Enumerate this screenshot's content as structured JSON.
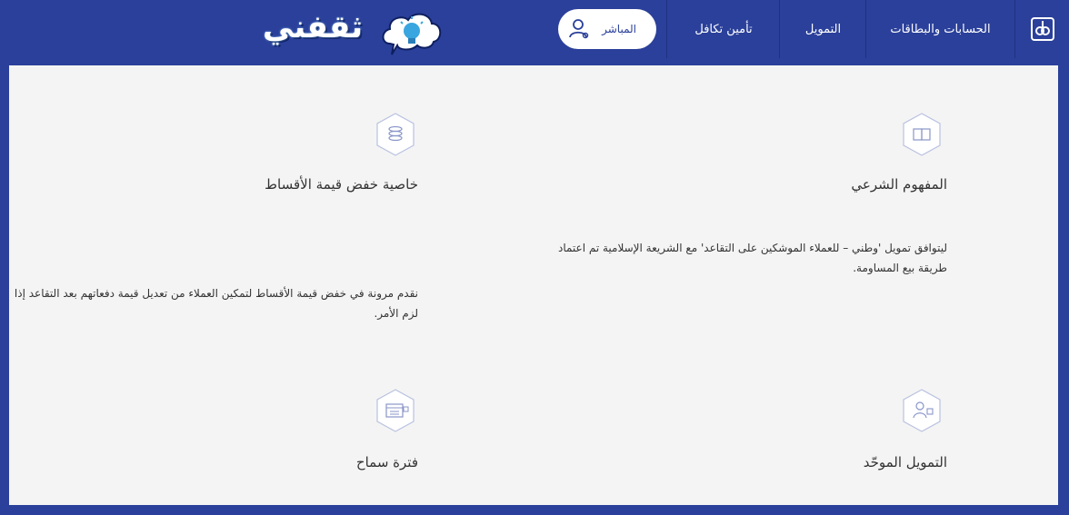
{
  "nav": {
    "accounts_label": "الحسابات والبطاقات",
    "finance_label": "التمويل",
    "takaful_label": "تأمين تكافل",
    "direct_label": "المباشر"
  },
  "brand": {
    "text": "ثقفني"
  },
  "features": [
    {
      "title": "المفهوم الشرعي",
      "description": "ليتوافق تمويل 'وطني – للعملاء الموشكين على التقاعد' مع الشريعة الإسلامية تم اعتماد طريقة بيع المساومة.",
      "icon": "book-icon"
    },
    {
      "title": "خاصية خفض قيمة الأقساط",
      "description": "نقدم مرونة في خفض قيمة الأقساط لتمكين العملاء من تعديل قيمة دفعاتهم بعد التقاعد إذا لزم الأمر.",
      "icon": "coins-icon"
    },
    {
      "title": "التمويل الموحّد",
      "icon": "person-money-icon"
    },
    {
      "title": "فترة سماح",
      "icon": "calendar-icon"
    }
  ],
  "colors": {
    "primary": "#2b409a",
    "panel": "#f4f4f4",
    "text": "#333333"
  }
}
